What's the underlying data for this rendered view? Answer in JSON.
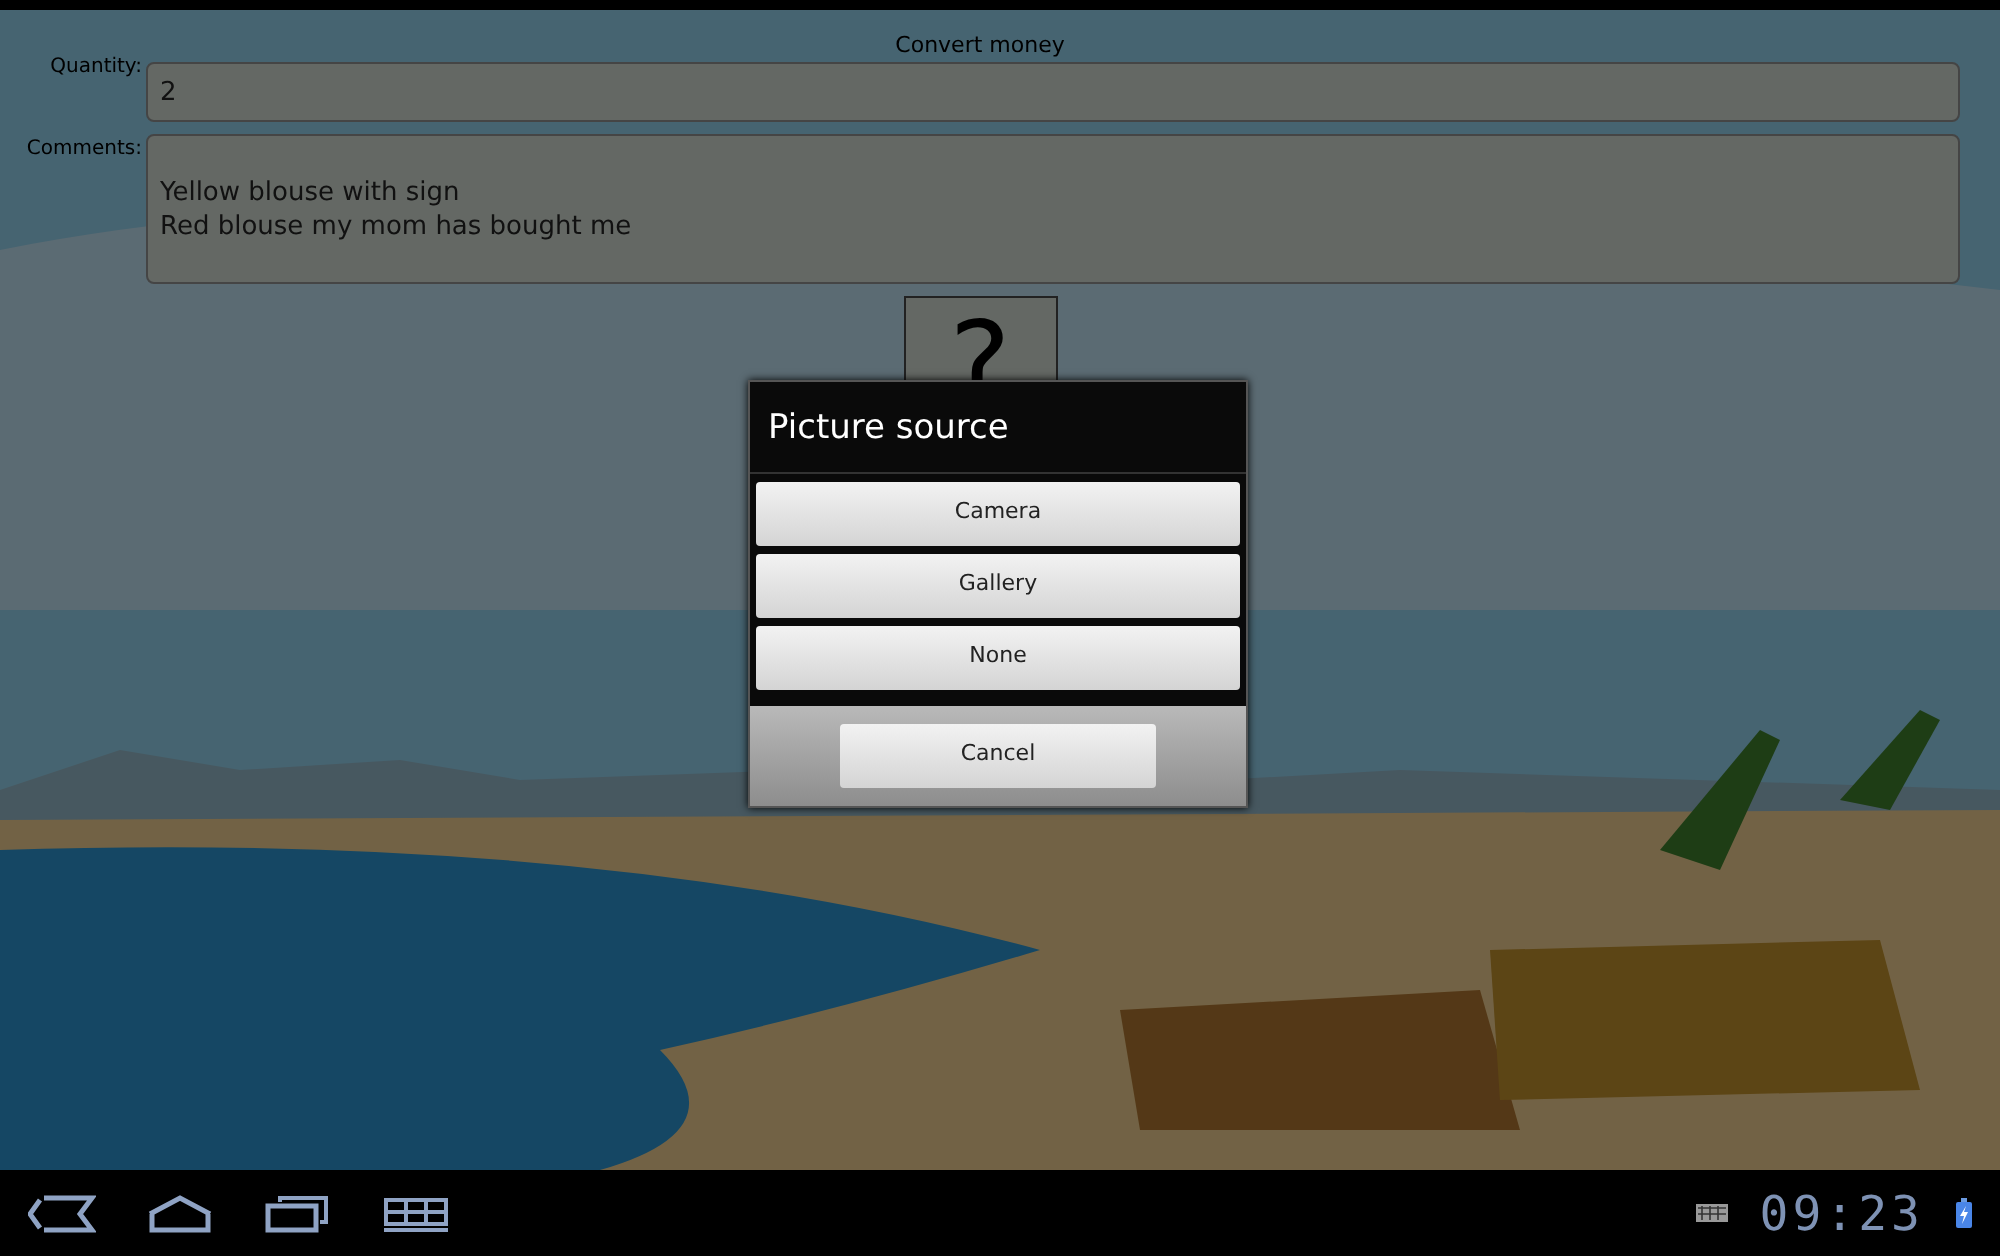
{
  "app": {
    "title": "Convert money"
  },
  "form": {
    "fields": [
      {
        "label": "Quantity:",
        "value": "2",
        "kind": "line"
      },
      {
        "label": "Comments:",
        "value": "Yellow blouse with sign\nRed blouse my mom has bought me",
        "kind": "multiline"
      }
    ]
  },
  "image_button": {
    "text": "?"
  },
  "dialog": {
    "title": "Picture source",
    "options": [
      "Camera",
      "Gallery",
      "None"
    ],
    "cancel": "Cancel"
  },
  "status_bar": {
    "time": "09:23"
  }
}
